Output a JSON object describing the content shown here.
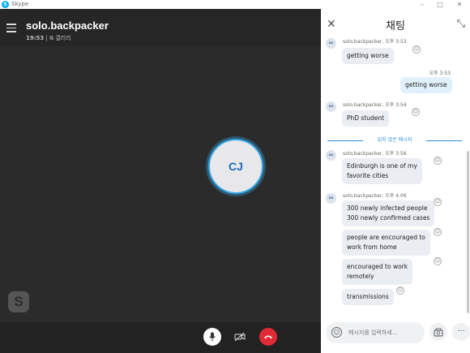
{
  "window": {
    "title": "Skype",
    "minimize_glyph": "–",
    "maximize_glyph": "□",
    "close_glyph": "✕"
  },
  "call": {
    "caller_name": "solo.backpacker",
    "duration": "19:53",
    "separator": "|",
    "gallery_label": "갤러리",
    "avatar_initials": "CJ",
    "watermark_letter": "S"
  },
  "chat": {
    "title": "채팅",
    "unread_divider": "읽지 않은 메시지",
    "compose_placeholder": "메시지를 입력하세...",
    "messages": [
      {
        "sender": "solo.backpacker, 오후 3:53",
        "text": "getting worse",
        "outgoing": false
      },
      {
        "time": "오후 3:53",
        "text": "getting worse",
        "outgoing": true
      },
      {
        "sender": "solo.backpacker, 오후 3:54",
        "text": "PhD student",
        "outgoing": false
      },
      {
        "sender": "solo.backpacker, 오후 3:56",
        "text_line1": "Edinburgh is one of my",
        "text_line2": "favorite cities",
        "outgoing": false
      },
      {
        "sender": "solo.backpacker, 오후 4:06",
        "text_line1": "300 newly infected people",
        "text_line2": "300 newly confirmed cases",
        "outgoing": false
      },
      {
        "text_line1": "people are encouraged to",
        "text_line2": "work from home",
        "outgoing": false
      },
      {
        "text_line1": "encouraged to work",
        "text_line2": "remotely",
        "outgoing": false
      },
      {
        "text": "transmissions",
        "outgoing": false
      }
    ]
  },
  "colors": {
    "call_background": "#2b2b2b",
    "accent_blue": "#2b8fe0",
    "hangup_red": "#e02a35",
    "outgoing_bubble": "#e1f1fb",
    "incoming_bubble": "#eaeef3"
  }
}
